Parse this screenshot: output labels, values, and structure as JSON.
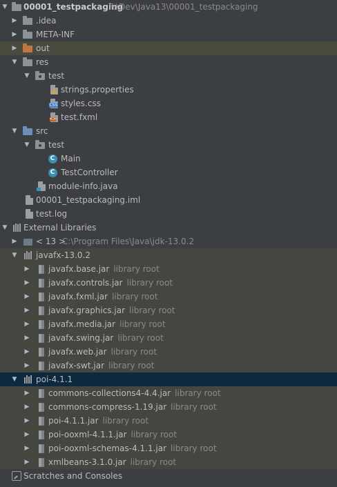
{
  "project": {
    "root": {
      "name": "00001_testpackaging",
      "path": "F:\\Dev\\Java13\\00001_testpackaging"
    },
    "idea": ".idea",
    "meta_inf": "META-INF",
    "out": "out",
    "res": "res",
    "res_test": "test",
    "res_files": [
      "strings.properties",
      "styles.css",
      "test.fxml"
    ],
    "src": "src",
    "src_test": "test",
    "src_files": [
      "Main",
      "TestController"
    ],
    "module_info": "module-info.java",
    "iml": "00001_testpackaging.iml",
    "log": "test.log"
  },
  "external": {
    "label": "External Libraries",
    "sdk": {
      "name": "< 13 >",
      "path": "C:\\Program Files\\Java\\jdk-13.0.2"
    },
    "javafx": {
      "name": "javafx-13.0.2",
      "jars": [
        "javafx.base.jar",
        "javafx.controls.jar",
        "javafx.fxml.jar",
        "javafx.graphics.jar",
        "javafx.media.jar",
        "javafx.swing.jar",
        "javafx.web.jar",
        "javafx-swt.jar"
      ]
    },
    "poi": {
      "name": "poi-4.1.1",
      "jars": [
        "commons-collections4-4.4.jar",
        "commons-compress-1.19.jar",
        "poi-4.1.1.jar",
        "poi-ooxml-4.1.1.jar",
        "poi-ooxml-schemas-4.1.1.jar",
        "xmlbeans-3.1.0.jar"
      ]
    },
    "library_root": "library root"
  },
  "scratches": "Scratches and Consoles",
  "icons": {
    "expanded": "chevron-down-icon",
    "collapsed": "chevron-right-icon",
    "folder": "folder-icon",
    "excluded_folder": "excluded-folder-icon",
    "resources_folder": "resources-folder-icon",
    "source_folder": "source-folder-icon",
    "package": "package-icon",
    "properties": "properties-file-icon",
    "css": "css-file-icon",
    "fxml": "fxml-file-icon",
    "java_class": "java-class-icon",
    "jar": "jar-icon",
    "libraries": "libraries-icon",
    "sdk": "sdk-icon",
    "scratches": "scratches-icon"
  },
  "colors": {
    "background": "#3c3f41",
    "highlight_out": "#4b4a3f",
    "library_rows": "#464641",
    "selected": "#0d293e",
    "excluded_folder": "#c2773a",
    "source_folder": "#6e8fb7",
    "java_class": "#3b8fb5"
  }
}
